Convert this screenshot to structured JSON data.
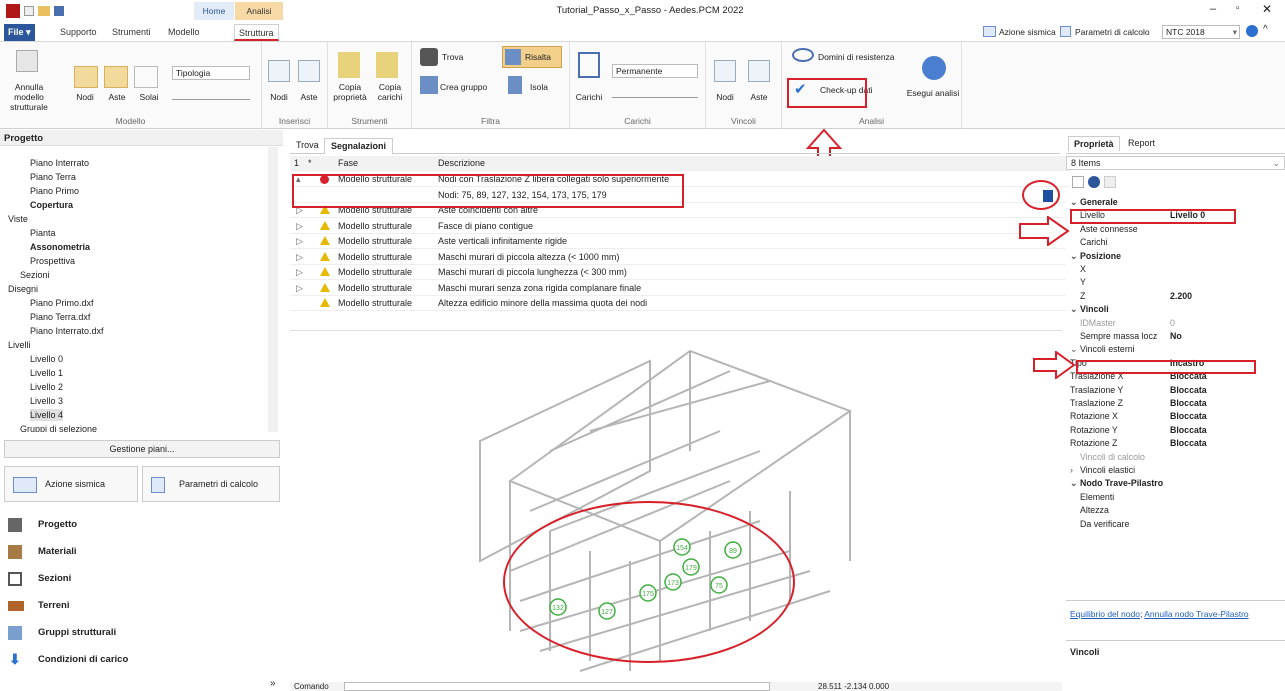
{
  "window": {
    "title": "Tutorial_Passo_x_Passo - Aedes.PCM 2022"
  },
  "quick": {
    "context_home": "Home",
    "context_analisi": "Analisi Elastiche"
  },
  "tabs": {
    "file": "File ▾",
    "supporto": "Supporto",
    "strumenti": "Strumenti",
    "modello": "Modello",
    "struttura": "Struttura"
  },
  "topright": {
    "azione": "Azione sismica",
    "parametri": "Parametri di calcolo",
    "ntc": "NTC 2018"
  },
  "ribbon": {
    "annulla": "Annulla modello strutturale",
    "nodi": "Nodi",
    "aste": "Aste",
    "solai": "Solai",
    "tipologia": "Tipologia",
    "g_modello": "Modello",
    "ins_nodi": "Nodi",
    "ins_aste": "Aste",
    "g_inserisci": "Inserisci",
    "copia_prop": "Copia proprietà",
    "copia_car": "Copia carichi",
    "g_strumenti": "Strumenti",
    "trova": "Trova",
    "risalta": "Risalta",
    "crea_gruppo": "Crea gruppo",
    "isola": "Isola",
    "g_filtra": "Filtra",
    "carichi": "Carichi",
    "permanente": "Permanente",
    "g_carichi": "Carichi",
    "v_nodi": "Nodi",
    "v_aste": "Aste",
    "g_vincoli": "Vincoli",
    "domini": "Domini di resistenza",
    "checkup": "Check-up dati",
    "esegui": "Esegui analisi",
    "g_analisi": "Analisi"
  },
  "progetto": {
    "title": "Progetto",
    "items": [
      "Piano Interrato",
      "Piano Terra",
      "Piano Primo",
      "Copertura",
      "Viste",
      "Pianta",
      "Assonometria",
      "Prospettiva",
      "Sezioni",
      "Disegni",
      "Piano Primo.dxf",
      "Piano Terra.dxf",
      "Piano Interrato.dxf",
      "Livelli",
      "Livello 0",
      "Livello 1",
      "Livello 2",
      "Livello 3",
      "Livello 4",
      "Gruppi di selezione"
    ]
  },
  "left": {
    "gestione": "Gestione piani...",
    "azione": "Azione sismica",
    "parametri": "Parametri di calcolo",
    "nav": [
      "Progetto",
      "Materiali",
      "Sezioni",
      "Terreni",
      "Gruppi strutturali",
      "Condizioni di carico"
    ]
  },
  "center": {
    "tab_trova": "Trova",
    "tab_segn": "Segnalazioni",
    "col_num": "1",
    "col_star": "*",
    "col_fase": "Fase",
    "col_desc": "Descrizione",
    "rows": [
      {
        "fase": "Modello strutturale",
        "desc": "Nodi con Traslazione Z libera collegati solo superiormente"
      },
      {
        "fase": "",
        "desc": "Nodi: 75, 89, 127, 132, 154, 173, 175, 179"
      },
      {
        "fase": "Modello strutturale",
        "desc": "Aste coincidenti con altre"
      },
      {
        "fase": "Modello strutturale",
        "desc": "Fasce di piano contigue"
      },
      {
        "fase": "Modello strutturale",
        "desc": "Aste verticali infinitamente rigide"
      },
      {
        "fase": "Modello strutturale",
        "desc": "Maschi murari di piccola altezza (< 1000 mm)"
      },
      {
        "fase": "Modello strutturale",
        "desc": "Maschi murari di piccola lunghezza (< 300 mm)"
      },
      {
        "fase": "Modello strutturale",
        "desc": "Maschi murari senza zona rigida complanare finale"
      },
      {
        "fase": "Modello strutturale",
        "desc": "Altezza edificio minore della massima quota dei nodi"
      }
    ],
    "nodes": [
      "154",
      "89",
      "179",
      "173",
      "75",
      "175",
      "132",
      "127"
    ],
    "comando": "Comando",
    "coords": "28.511  -2.134  0.000"
  },
  "right": {
    "tab_prop": "Proprietà",
    "tab_report": "Report",
    "items": "8 Items",
    "props": [
      {
        "k": "Generale",
        "v": "",
        "sec": true
      },
      {
        "k": "Livello",
        "v": "Livello 0"
      },
      {
        "k": "Aste connesse",
        "v": ""
      },
      {
        "k": "Carichi",
        "v": ""
      },
      {
        "k": "Posizione",
        "v": "",
        "sec": true
      },
      {
        "k": "X",
        "v": ""
      },
      {
        "k": "Y",
        "v": ""
      },
      {
        "k": "Z",
        "v": "2.200"
      },
      {
        "k": "Vincoli",
        "v": "",
        "sec": true
      },
      {
        "k": "IDMaster",
        "v": "0",
        "grey": true
      },
      {
        "k": "Sempre massa locz",
        "v": "No"
      },
      {
        "k": "Vincoli esterni",
        "v": "",
        "sub": true
      },
      {
        "k": "Tipo",
        "v": "Incastro",
        "ind": true
      },
      {
        "k": "Traslazione X",
        "v": "Bloccata",
        "ind": true
      },
      {
        "k": "Traslazione Y",
        "v": "Bloccata",
        "ind": true
      },
      {
        "k": "Traslazione Z",
        "v": "Bloccata",
        "ind": true
      },
      {
        "k": "Rotazione X",
        "v": "Bloccata",
        "ind": true
      },
      {
        "k": "Rotazione Y",
        "v": "Bloccata",
        "ind": true
      },
      {
        "k": "Rotazione Z",
        "v": "Bloccata",
        "ind": true
      },
      {
        "k": "Vincoli di calcolo",
        "v": "",
        "grey": true
      },
      {
        "k": "Vincoli elastici",
        "v": "",
        "sub": true
      },
      {
        "k": "Nodo Trave-Pilastro",
        "v": "",
        "sec": true
      },
      {
        "k": "Elementi",
        "v": ""
      },
      {
        "k": "Altezza",
        "v": ""
      },
      {
        "k": "Da verificare",
        "v": ""
      }
    ],
    "link1": "Equilibrio del nodo",
    "link_sep": "; ",
    "link2": "Annulla nodo Trave-Pilastro",
    "footer": "Vincoli"
  },
  "colors": {
    "accent": "#2b579a",
    "highlight": "#d8202a",
    "node": "#3fae3f"
  }
}
